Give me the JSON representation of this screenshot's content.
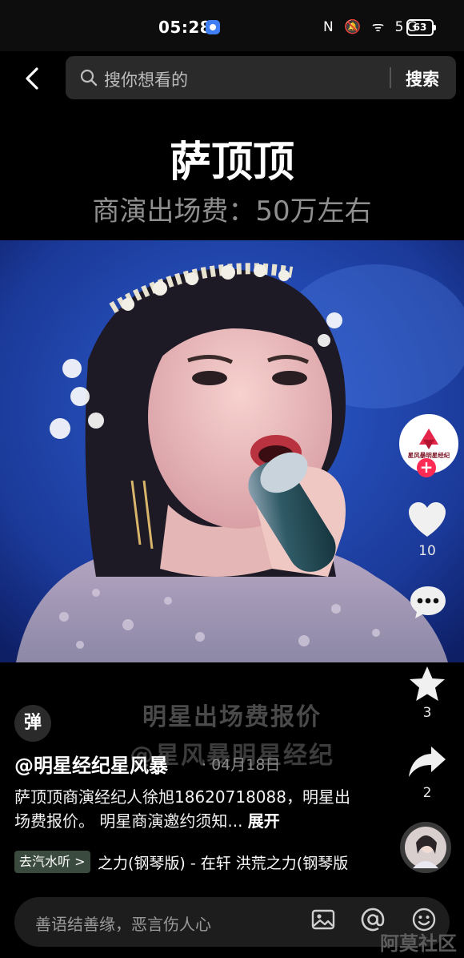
{
  "status_bar": {
    "time": "05:28",
    "icons": "N 🔕 ᯤ 5G",
    "battery": "63"
  },
  "search": {
    "placeholder": "搜你想看的",
    "button": "搜索"
  },
  "video": {
    "title": "萨顶顶",
    "subtitle": "商演出场费：50万左右",
    "watermark_line1": "明星出场费报价",
    "watermark_line2": "@星风暴明星经纪"
  },
  "actions": {
    "avatar_text": "星风暴明星经纪",
    "like_count": "10",
    "favorite_count": "3",
    "share_count": "2"
  },
  "danmaku_button": "弹",
  "post": {
    "author": "@明星经纪星风暴",
    "date": "· 04月18日",
    "description": "萨顶顶商演经纪人徐旭18620718088，明星出场费报价。 明星商演邀约须知...",
    "expand": "展开"
  },
  "music": {
    "tag": "去汽水听 >",
    "text": "之力(钢琴版) - 在轩    洪荒之力(钢琴版"
  },
  "comment": {
    "placeholder": "善语结善缘，恶言伤人心"
  },
  "corner_watermark": "阿莫社区",
  "colors": {
    "like_red": "#fe2c55",
    "background": "#000000",
    "search_bg": "#2a2a2a"
  }
}
